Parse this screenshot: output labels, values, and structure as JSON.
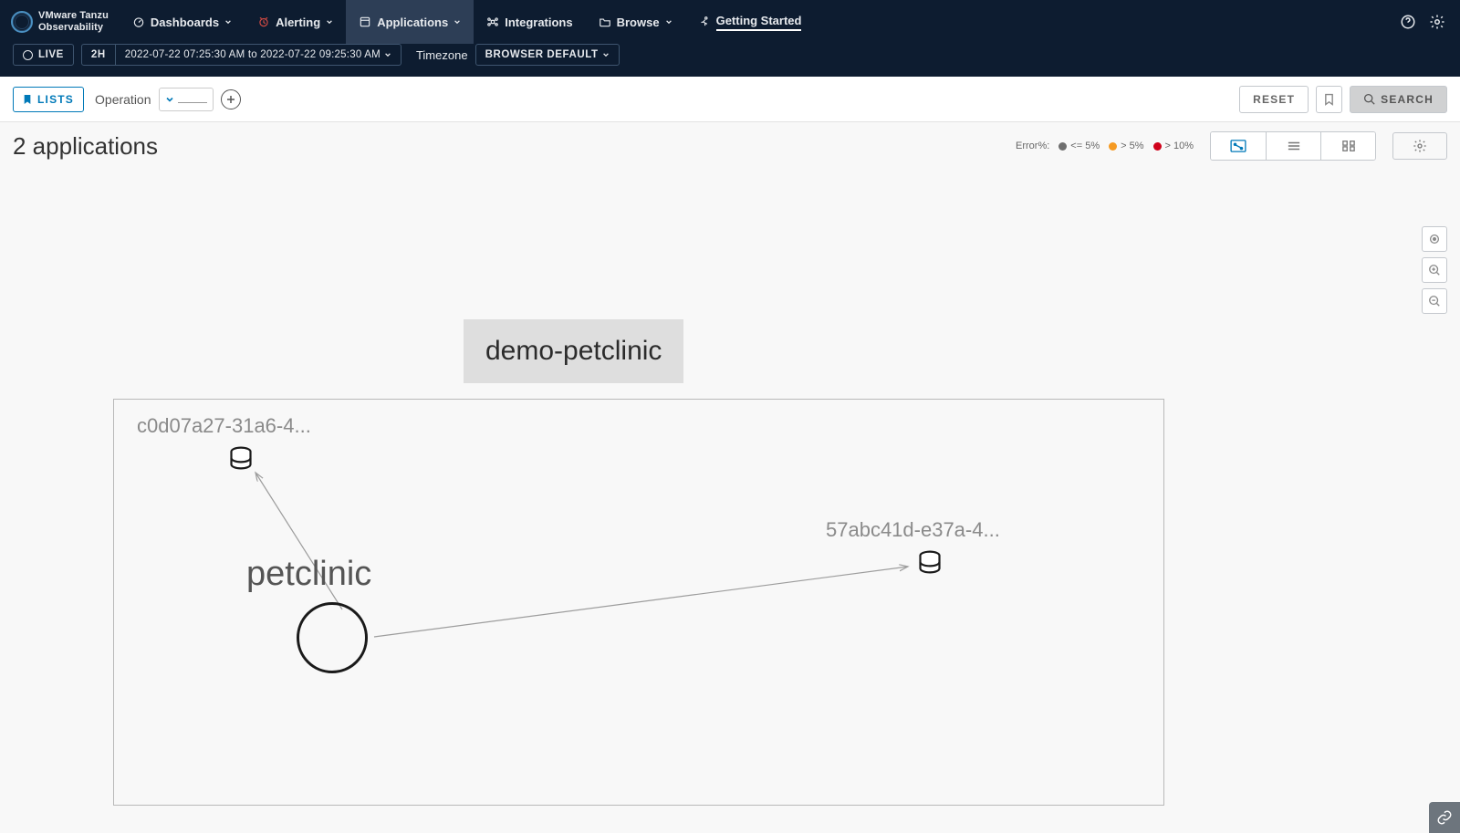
{
  "brand": {
    "line1": "VMware Tanzu",
    "line2": "Observability"
  },
  "nav": {
    "dashboards": "Dashboards",
    "alerting": "Alerting",
    "applications": "Applications",
    "integrations": "Integrations",
    "browse": "Browse",
    "getting_started": "Getting Started"
  },
  "timebar": {
    "live": "LIVE",
    "window": "2H",
    "range": "2022-07-22 07:25:30 AM  to  2022-07-22 09:25:30 AM",
    "tz_label": "Timezone",
    "tz_value": "BROWSER DEFAULT"
  },
  "filters": {
    "lists": "LISTS",
    "operation_label": "Operation",
    "reset": "RESET",
    "search": "SEARCH"
  },
  "summary": {
    "count_label": "2 applications"
  },
  "legend": {
    "label": "Error%:",
    "low": "<= 5%",
    "mid": "> 5%",
    "high": "> 10%"
  },
  "map": {
    "app_title": "demo-petclinic",
    "node_petclinic": "petclinic",
    "node_db1": "c0d07a27-31a6-4...",
    "node_db2": "57abc41d-e37a-4..."
  }
}
